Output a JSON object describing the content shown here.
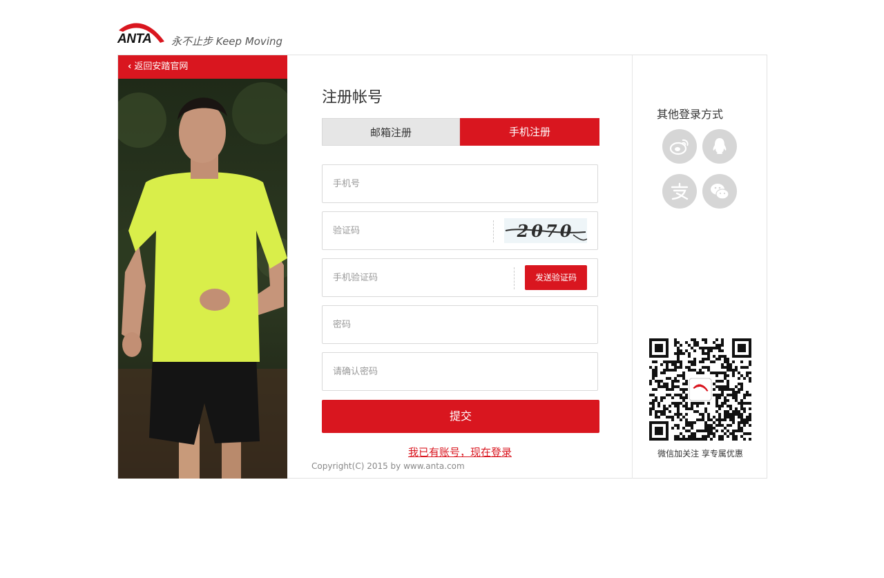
{
  "brand": {
    "logo_text": "ANTA",
    "slogan": "永不止步 Keep Moving"
  },
  "left": {
    "back_label": "返回安踏官网"
  },
  "form": {
    "title": "注册帐号",
    "tabs": [
      {
        "label": "邮箱注册",
        "active": false
      },
      {
        "label": "手机注册",
        "active": true
      }
    ],
    "phone_placeholder": "手机号",
    "captcha_placeholder": "验证码",
    "captcha_text": "2070",
    "sms_placeholder": "手机验证码",
    "send_code_label": "发送验证码",
    "password_placeholder": "密码",
    "confirm_placeholder": "请确认密码",
    "submit_label": "提交",
    "login_link": "我已有账号，现在登录",
    "copyright": "Copyright(C) 2015 by www.anta.com"
  },
  "right": {
    "title": "其他登录方式",
    "social": [
      {
        "name": "weibo-icon"
      },
      {
        "name": "qq-icon"
      },
      {
        "name": "alipay-icon"
      },
      {
        "name": "wechat-icon"
      }
    ],
    "qr_caption": "微信加关注 享专属优惠"
  },
  "colors": {
    "accent": "#d9161f",
    "tab_inactive": "#e6e6e6",
    "social_bg": "#d6d6d6"
  }
}
